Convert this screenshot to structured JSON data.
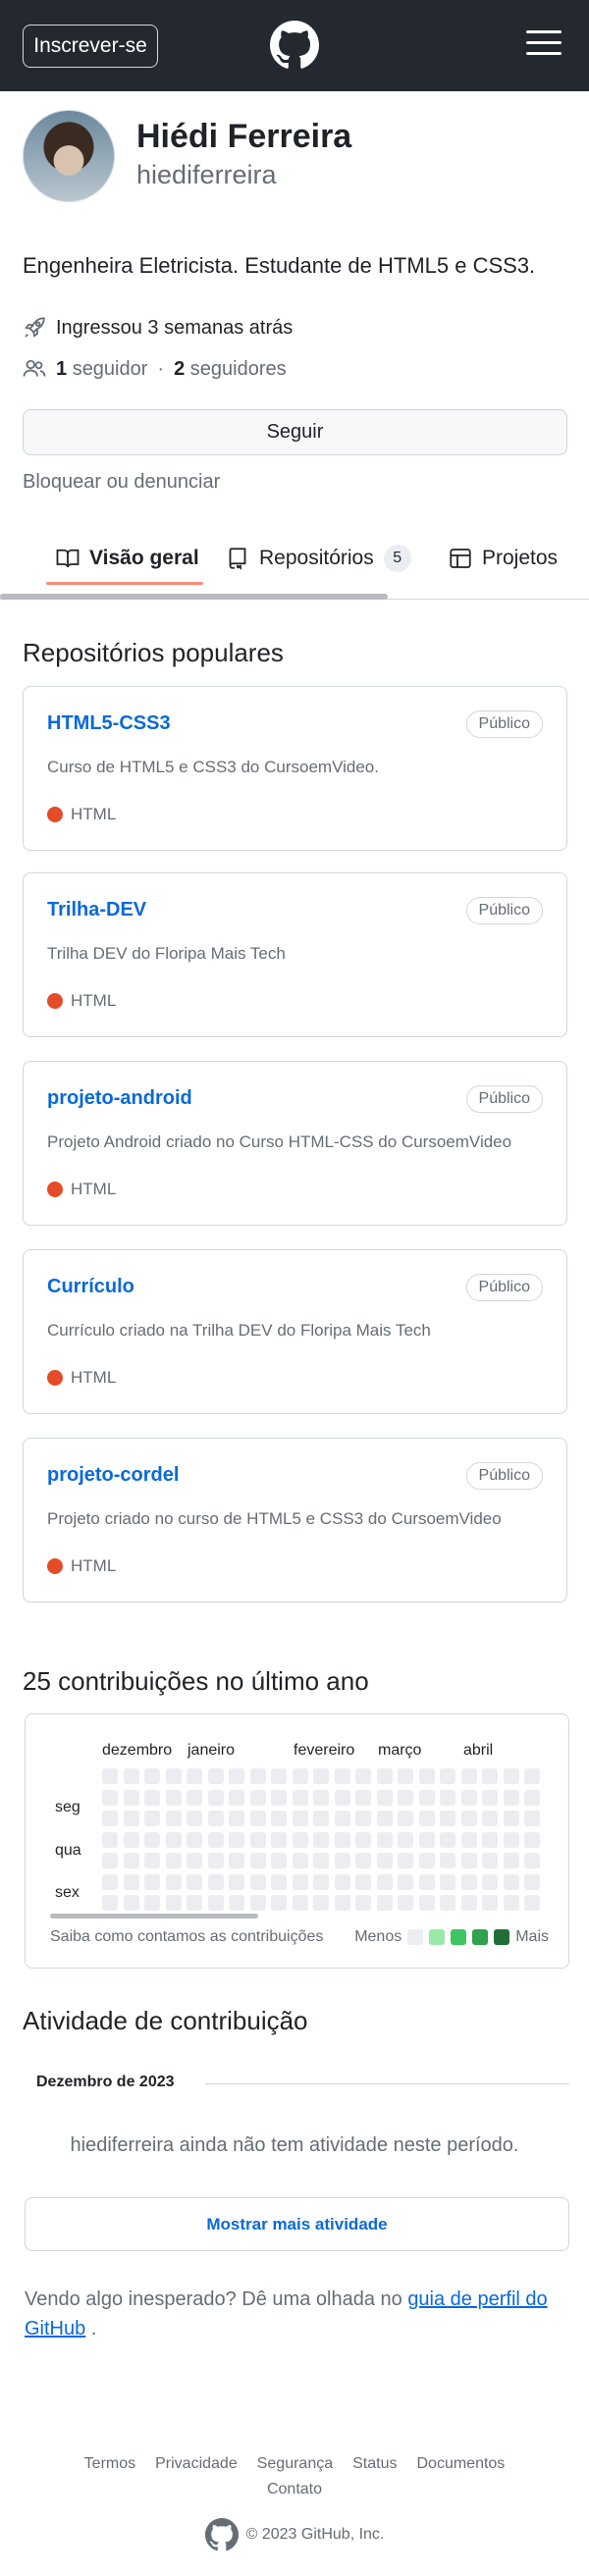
{
  "header": {
    "signup_label": "Inscrever-se",
    "logo_icon": "github-mark-icon",
    "menu_icon": "hamburger-menu-icon"
  },
  "profile": {
    "name": "Hiédi Ferreira",
    "login": "hiediferreira",
    "bio": "Engenheira Eletricista. Estudante de HTML5 e CSS3.",
    "joined": "Ingressou 3 semanas atrás",
    "followers_count": "1",
    "followers_label": "seguidor",
    "separator": "·",
    "following_count": "2",
    "following_label": "seguidores",
    "follow_label": "Seguir",
    "block_label": "Bloquear ou denunciar"
  },
  "tabs": [
    {
      "label": "Visão geral",
      "icon": "book-icon"
    },
    {
      "label": "Repositórios",
      "icon": "repo-icon",
      "count": "5"
    },
    {
      "label": "Projetos",
      "icon": "table-icon"
    }
  ],
  "popular": {
    "title": "Repositórios populares",
    "repos": [
      {
        "name": "HTML5-CSS3",
        "visibility": "Público",
        "description": "Curso de HTML5 e CSS3 do CursoemVideo.",
        "language": "HTML"
      },
      {
        "name": "Trilha-DEV",
        "visibility": "Público",
        "description": "Trilha DEV do Floripa Mais Tech",
        "language": "HTML"
      },
      {
        "name": "projeto-android",
        "visibility": "Público",
        "description": "Projeto Android criado no Curso HTML-CSS do CursoemVideo",
        "language": "HTML"
      },
      {
        "name": "Currículo",
        "visibility": "Público",
        "description": "Currículo criado na Trilha DEV do Floripa Mais Tech",
        "language": "HTML"
      },
      {
        "name": "projeto-cordel",
        "visibility": "Público",
        "description": "Projeto criado no curso de HTML5 e CSS3 do CursoemVideo",
        "language": "HTML"
      }
    ]
  },
  "contributions": {
    "title": "25 contribuições no último ano",
    "months": [
      "dezembro",
      "janeiro",
      "fevereiro",
      "março",
      "abril"
    ],
    "days": [
      "seg",
      "qua",
      "sex"
    ],
    "help_text": "Saiba como contamos as contribuições",
    "legend_less": "Menos",
    "legend_more": "Mais",
    "legend_colors": [
      "#ebedf0",
      "#9be9a8",
      "#40c463",
      "#30a14e",
      "#216e39"
    ]
  },
  "activity": {
    "title": "Atividade de contribuição",
    "month_header": "Dezembro de 2023",
    "empty_text": "hiediferreira ainda não tem atividade neste período.",
    "show_more_label": "Mostrar mais atividade"
  },
  "feedback": {
    "text": "Vendo algo inesperado? Dê uma olhada no",
    "link_text": "guia de perfil do GitHub",
    "suffix": "."
  },
  "footer": {
    "links": [
      "Termos",
      "Privacidade",
      "Segurança",
      "Status",
      "Documentos",
      "Contato"
    ],
    "copyright": "© 2023 GitHub, Inc."
  }
}
